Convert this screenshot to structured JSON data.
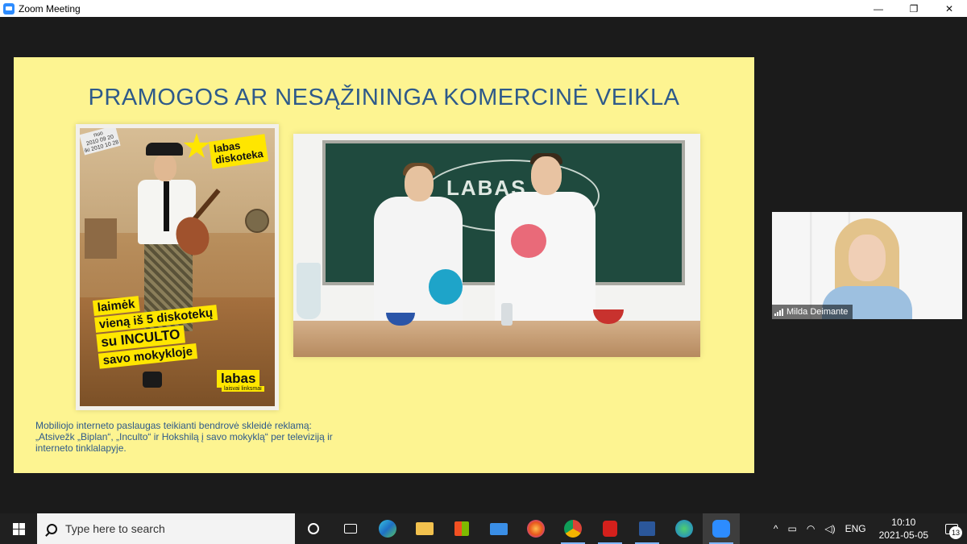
{
  "window": {
    "title": "Zoom Meeting",
    "controls": {
      "minimize": "—",
      "restore": "❐",
      "close": "✕"
    }
  },
  "slide": {
    "title": "PRAMOGOS AR NESĄŽININGA KOMERCINĖ VEIKLA",
    "poster": {
      "date_line1": "nuo",
      "date_line2": "2010 09 20",
      "date_line3": "iki 2010 10 28",
      "brand_top_line1": "labas",
      "brand_top_line2": "diskoteka",
      "promo_line1": "laimėk",
      "promo_line2": "vieną iš 5 diskotekų",
      "promo_line3": "su INCULTO",
      "promo_line4": "savo mokykloje",
      "brand_bottom": "labas",
      "brand_tagline": "laisvai linksmai"
    },
    "video": {
      "chalk_text": "LABAS"
    },
    "caption_line1": "Mobiliojo interneto paslaugas teikianti bendrovė skleidė reklamą:",
    "caption_line2": "„Atsivežk „Biplan“, „Inculto“ ir Hokshilą į savo mokyklą“ per televiziją ir",
    "caption_line3": "interneto tinklalapyje."
  },
  "participant": {
    "name": "Milda Deimante"
  },
  "taskbar": {
    "search_placeholder": "Type here to search",
    "apps": [
      "cortana-icon",
      "task-view-icon",
      "edge-icon",
      "file-explorer-icon",
      "store-icon",
      "mail-icon",
      "firefox-icon",
      "chrome-icon",
      "acrobat-icon",
      "word-icon",
      "network-globe-icon",
      "zoom-icon"
    ],
    "language": "ENG",
    "time": "10:10",
    "date": "2021-05-05",
    "notification_count": "13",
    "tray_chevron": "^"
  },
  "colors": {
    "slide_bg": "#fdf491",
    "title_color": "#2e5a8a",
    "zoom_blue": "#2d8cff",
    "taskbar_bg": "#202020"
  }
}
